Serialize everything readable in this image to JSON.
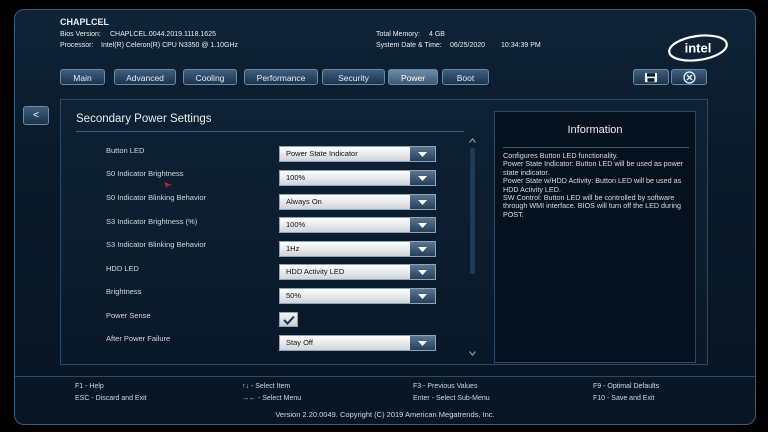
{
  "header": {
    "brand": "CHAPLCEL",
    "bios_label": "Bios Version:",
    "bios_value": "CHAPLCEL.0044.2019.1118.1625",
    "proc_label": "Processor:",
    "proc_value": "Intel(R) Celeron(R) CPU N3350 @ 1.10GHz",
    "mem_label": "Total Memory:",
    "mem_value": "4 GB",
    "dt_label": "System Date & Time:",
    "date": "06/25/2020",
    "time": "10:34:39 PM",
    "logo_text": "intel"
  },
  "tabs": [
    {
      "label": "Main"
    },
    {
      "label": "Advanced"
    },
    {
      "label": "Cooling"
    },
    {
      "label": "Performance"
    },
    {
      "label": "Security"
    },
    {
      "label": "Power",
      "active": true
    },
    {
      "label": "Boot"
    }
  ],
  "icons": {
    "save": "save-icon",
    "exit": "close-circle-icon",
    "back": "<"
  },
  "panel": {
    "title": "Secondary Power Settings"
  },
  "settings": [
    {
      "label": "Button LED",
      "type": "dropdown",
      "value": "Power State Indicator"
    },
    {
      "label": "S0 Indicator Brightness",
      "type": "dropdown",
      "value": "100%"
    },
    {
      "label": "S0 Indicator Blinking Behavior",
      "type": "dropdown",
      "value": "Always On"
    },
    {
      "label": "S3 Indicator Brightness (%)",
      "type": "dropdown",
      "value": "100%"
    },
    {
      "label": "S3 Indicator Blinking Behavior",
      "type": "dropdown",
      "value": "1Hz"
    },
    {
      "label": "HDD LED",
      "type": "dropdown",
      "value": "HDD Activity LED"
    },
    {
      "label": "Brightness",
      "type": "dropdown",
      "value": "50%"
    },
    {
      "label": "Power Sense",
      "type": "checkbox",
      "checked": true
    },
    {
      "label": "After Power Failure",
      "type": "dropdown",
      "value": "Stay Off"
    }
  ],
  "info": {
    "title": "Information",
    "text": "Configures Button LED functionality.\n Power State Indicator: Button LED will be used as power state indicator.\n Power State w/HDD Activity: Button LED will be used as HDD Activity LED.\n SW Control: Button LED will be controlled by software through WMI interface. BIOS will turn off the LED during POST."
  },
  "footer": {
    "help_left_1": "F1 - Help",
    "help_left_2": "ESC - Discard and Exit",
    "help_mid_1": "↑↓ - Select Item",
    "help_mid_2": "→← - Select Menu",
    "help_right_1": "F3 - Previous Values",
    "help_right_2": "Enter - Select Sub-Menu",
    "help_far_1": "F9 - Optimal Defaults",
    "help_far_2": "F10 - Save and Exit",
    "version": "Version 2.20.0049. Copyright (C) 2019 American Megatrends, Inc."
  }
}
